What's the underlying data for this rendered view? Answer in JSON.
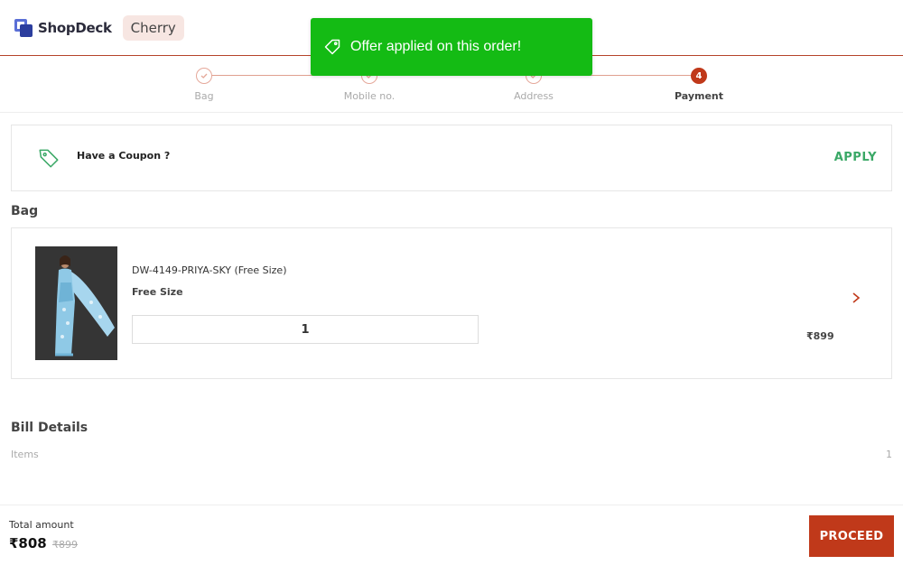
{
  "header": {
    "brand": "ShopDeck",
    "store_name": "Cherry"
  },
  "toast": {
    "message": "Offer applied on this order!",
    "color": "#14bb14"
  },
  "stepper": {
    "steps": [
      {
        "label": "Bag",
        "state": "done"
      },
      {
        "label": "Mobile no.",
        "state": "done"
      },
      {
        "label": "Address",
        "state": "done"
      },
      {
        "label": "Payment",
        "state": "active",
        "number": "4"
      }
    ]
  },
  "coupon": {
    "prompt": "Have a Coupon ?",
    "action": "APPLY"
  },
  "bag": {
    "title": "Bag",
    "items": [
      {
        "name": "DW-4149-PRIYA-SKY (Free Size)",
        "size": "Free Size",
        "quantity": "1",
        "price": "₹899"
      }
    ]
  },
  "bill": {
    "title": "Bill Details",
    "rows": [
      {
        "label": "Items",
        "value": "1"
      }
    ]
  },
  "footer": {
    "total_label": "Total amount",
    "total": "₹808",
    "original_total": "₹899",
    "proceed_label": "PROCEED"
  },
  "colors": {
    "accent": "#c0391a",
    "success": "#3aa866",
    "brand": "#2c3e9e"
  }
}
